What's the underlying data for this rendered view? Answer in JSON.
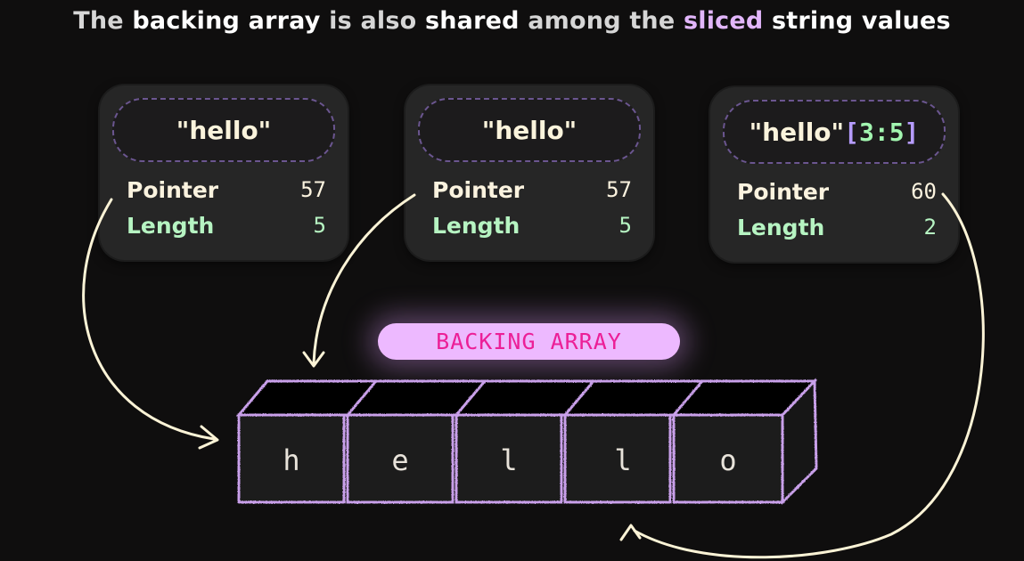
{
  "title": {
    "part1": "The",
    "part2": "backing array",
    "part3": "is also",
    "part4": "shared",
    "part5": "among the",
    "part6": "sliced",
    "part7": "string values"
  },
  "strings": [
    {
      "literal": "\"hello\"",
      "pointer_label": "Pointer",
      "pointer_value": "57",
      "length_label": "Length",
      "length_value": "5"
    },
    {
      "literal": "\"hello\"",
      "pointer_label": "Pointer",
      "pointer_value": "57",
      "length_label": "Length",
      "length_value": "5"
    },
    {
      "literal": "\"hello\"",
      "slice_open": "[",
      "slice_start": "3",
      "slice_colon": ":",
      "slice_end": "5",
      "slice_close": "]",
      "pointer_label": "Pointer",
      "pointer_value": "60",
      "length_label": "Length",
      "length_value": "2"
    }
  ],
  "backing_array": {
    "label": "BACKING ARRAY",
    "cells": [
      "h",
      "e",
      "l",
      "l",
      "o"
    ]
  },
  "colors": {
    "background": "#0f0e0e",
    "card": "#262626",
    "accent_purple": "#e2b6fb",
    "label_pill": "#edb9ff",
    "label_text": "#ec1f97",
    "pointer_text": "#fbf3df",
    "length_text": "#b6f4c2",
    "arrow": "#fbf3d6",
    "box_outline": "#c9a0ea"
  }
}
